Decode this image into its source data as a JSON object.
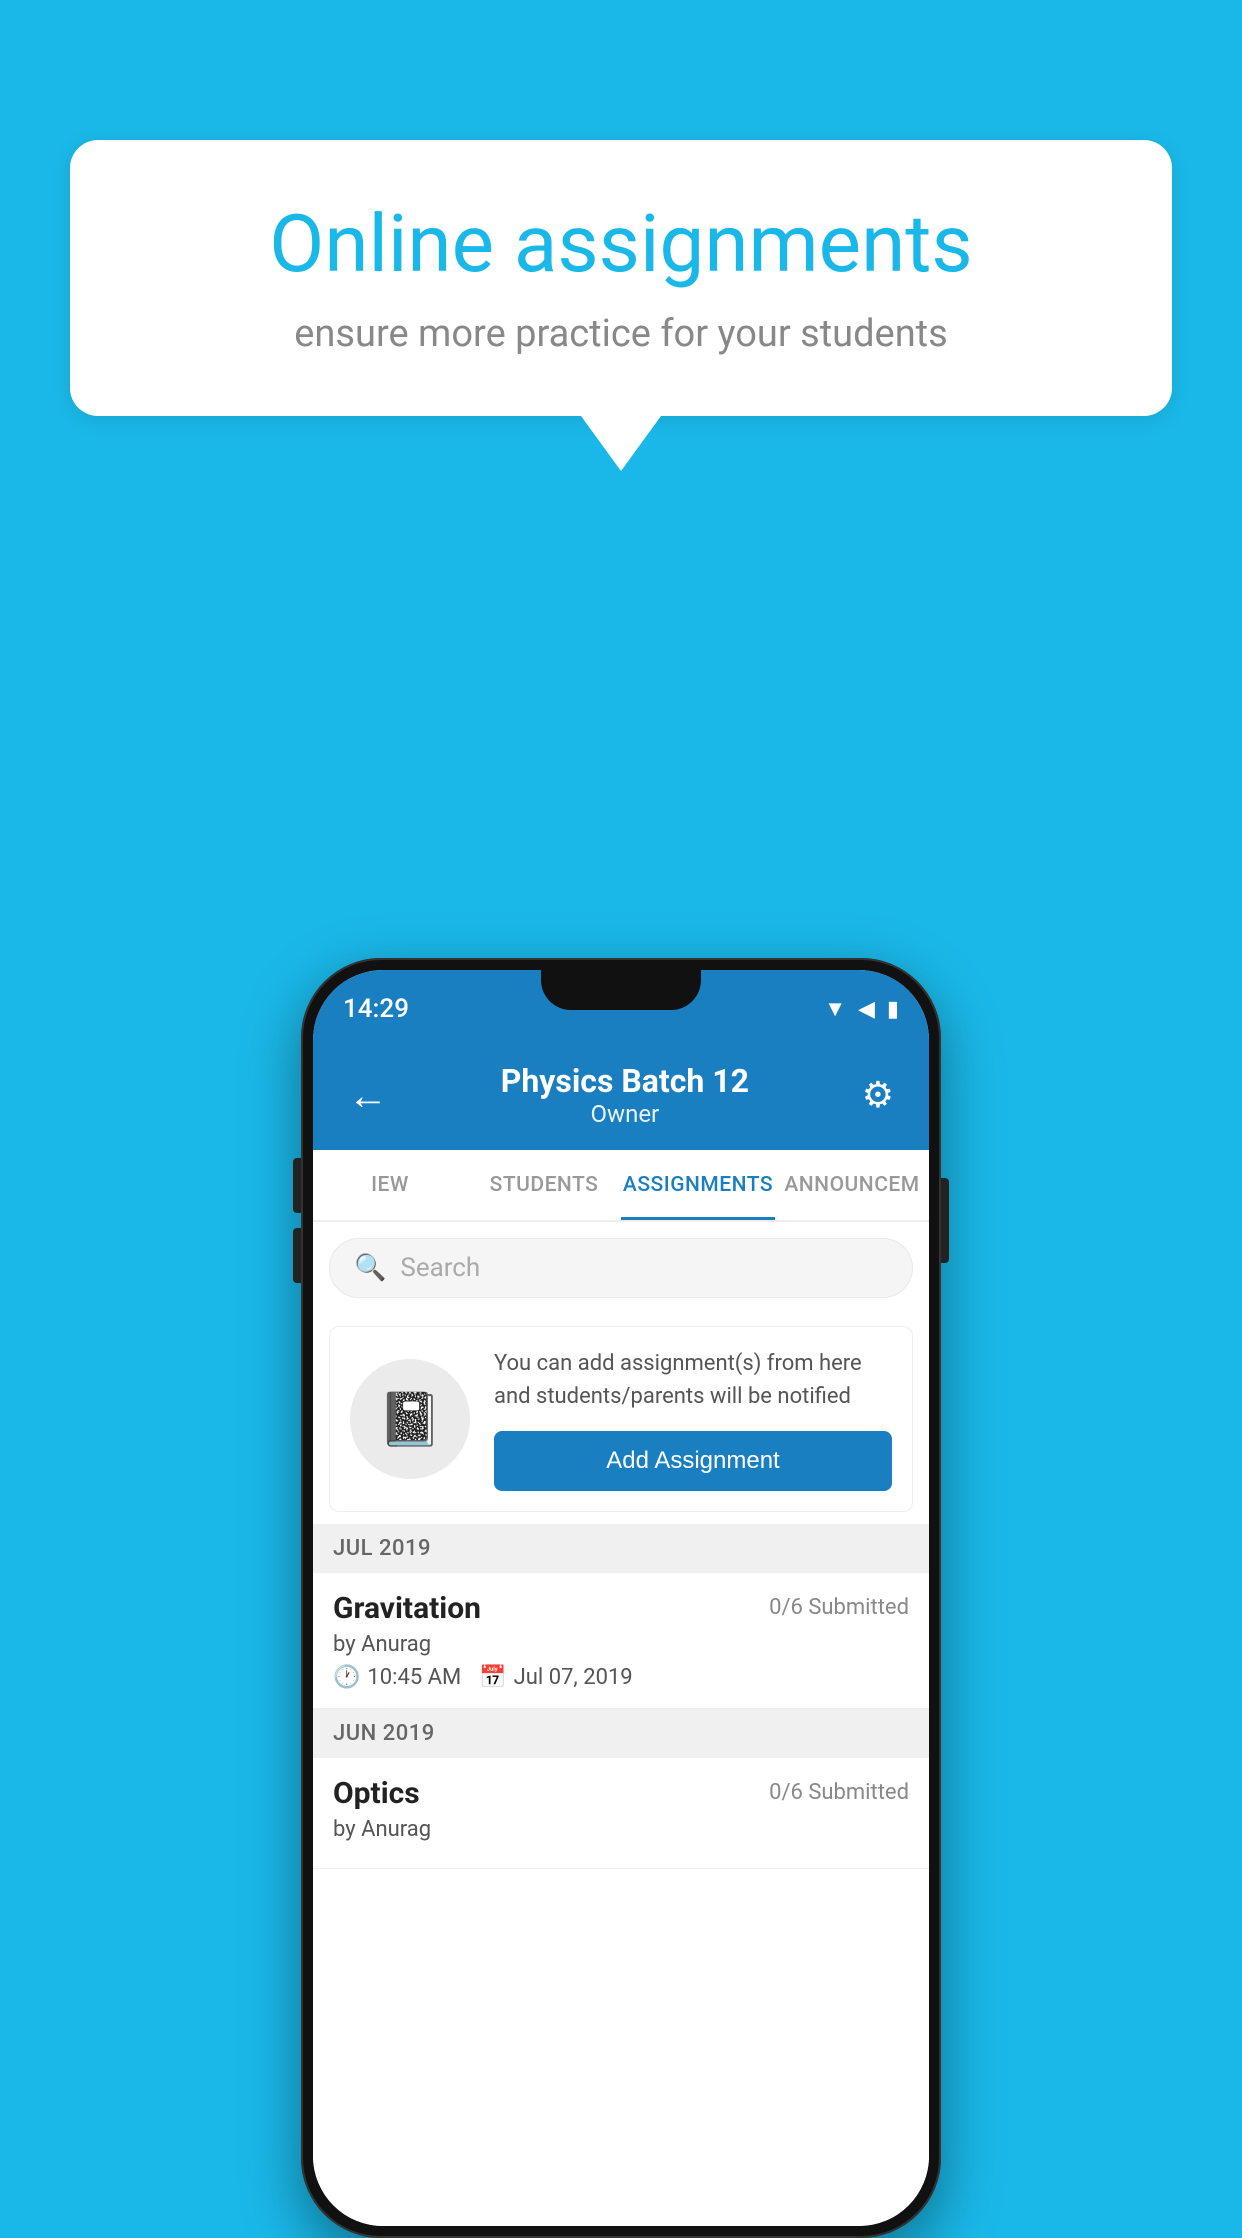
{
  "background_color": "#1ab8e8",
  "speech_bubble": {
    "title": "Online assignments",
    "subtitle": "ensure more practice for your students"
  },
  "status_bar": {
    "time": "14:29",
    "icons": [
      "wifi",
      "signal",
      "battery"
    ]
  },
  "app_bar": {
    "title": "Physics Batch 12",
    "subtitle": "Owner",
    "back_label": "←",
    "settings_label": "⚙"
  },
  "tabs": [
    {
      "label": "IEW",
      "active": false
    },
    {
      "label": "STUDENTS",
      "active": false
    },
    {
      "label": "ASSIGNMENTS",
      "active": true
    },
    {
      "label": "ANNOUNCEM",
      "active": false
    }
  ],
  "search": {
    "placeholder": "Search"
  },
  "add_assignment_card": {
    "description": "You can add assignment(s) from here and students/parents will be notified",
    "button_label": "Add Assignment"
  },
  "sections": [
    {
      "month_label": "JUL 2019",
      "assignments": [
        {
          "name": "Gravitation",
          "submitted": "0/6 Submitted",
          "by": "by Anurag",
          "time": "10:45 AM",
          "date": "Jul 07, 2019"
        }
      ]
    },
    {
      "month_label": "JUN 2019",
      "assignments": [
        {
          "name": "Optics",
          "submitted": "0/6 Submitted",
          "by": "by Anurag",
          "time": "",
          "date": ""
        }
      ]
    }
  ]
}
